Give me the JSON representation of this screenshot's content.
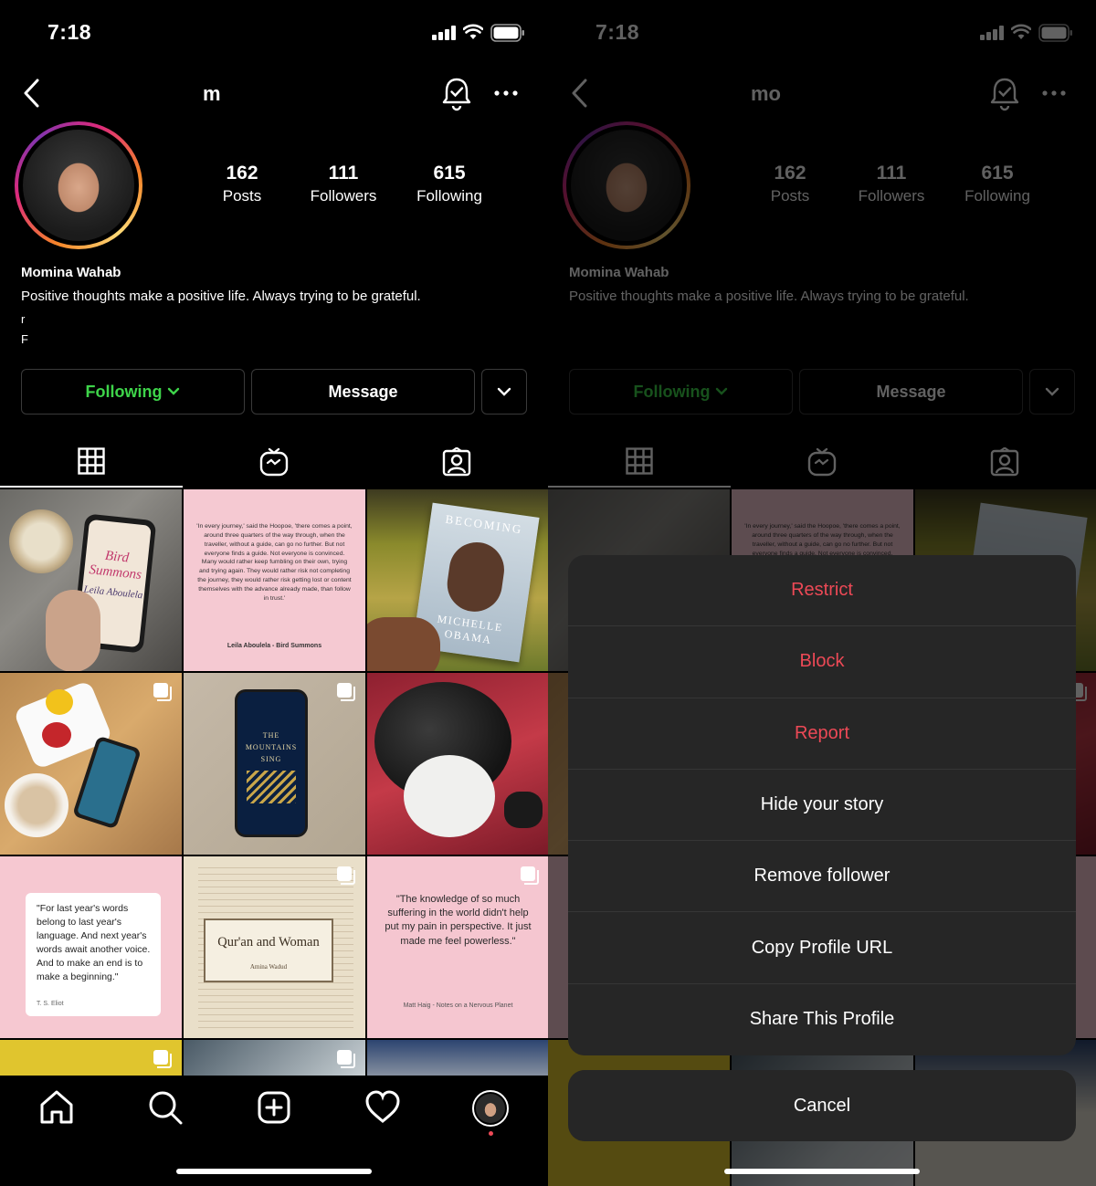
{
  "status": {
    "time": "7:18"
  },
  "profile": {
    "username_partial_left": "m",
    "username_partial_right": "mo",
    "name": "Momina Wahab",
    "bio": "Positive thoughts make a positive life. Always trying to be grateful.",
    "bio_line2": "r",
    "bio_line3": "F",
    "stats": [
      {
        "num": "162",
        "label": "Posts"
      },
      {
        "num": "111",
        "label": "Followers"
      },
      {
        "num": "615",
        "label": "Following"
      }
    ]
  },
  "buttons": {
    "following": "Following",
    "message": "Message"
  },
  "posts": {
    "quote1": "'In every journey,' said the Hoopoe, 'there comes a point, around three quarters of the way through, when the traveller, without a guide, can go no further. But not everyone finds a guide. Not everyone is convinced. Many would rather keep fumbling on their own, trying and trying again. They would rather risk not completing the journey, they would rather risk getting lost or content themselves with the advance already made, than follow in trust.'",
    "quote1_source": "Leila Aboulela - Bird Summons",
    "book1_cover": "Bird Summons",
    "book1_author": "Leila Aboulela",
    "book2_title": "BECOMING",
    "book2_author": "MICHELLE OBAMA",
    "book3_title": "THE MOUNTAINS SING",
    "quote2": "\"For last year's words belong to last year's language. And next year's words await another voice. And to make an end is to make a beginning.\"",
    "quote2_source": "T. S. Eliot",
    "book4_title": "Qur'an and Woman",
    "book4_author": "Amina Wadud",
    "quote3": "\"The knowledge of so much suffering in the world didn't help put my pain in perspective. It just made me feel powerless.\"",
    "quote3_source": "Matt Haig - Notes on a Nervous Planet"
  },
  "menu": {
    "options": [
      {
        "label": "Restrict",
        "danger": true
      },
      {
        "label": "Block",
        "danger": true
      },
      {
        "label": "Report",
        "danger": true
      },
      {
        "label": "Hide your story",
        "danger": false
      },
      {
        "label": "Remove follower",
        "danger": false
      },
      {
        "label": "Copy Profile URL",
        "danger": false
      },
      {
        "label": "Share This Profile",
        "danger": false
      }
    ],
    "cancel": "Cancel"
  },
  "colors": {
    "following_green": "#3ed44a",
    "danger_red": "#ed4956",
    "sheet_bg": "#262626"
  },
  "icons": [
    "back-icon",
    "notification-bell-icon",
    "more-icon",
    "chevron-down-icon",
    "grid-icon",
    "igtv-icon",
    "tagged-icon",
    "home-icon",
    "search-icon",
    "create-post-icon",
    "activity-heart-icon",
    "profile-avatar-icon"
  ]
}
